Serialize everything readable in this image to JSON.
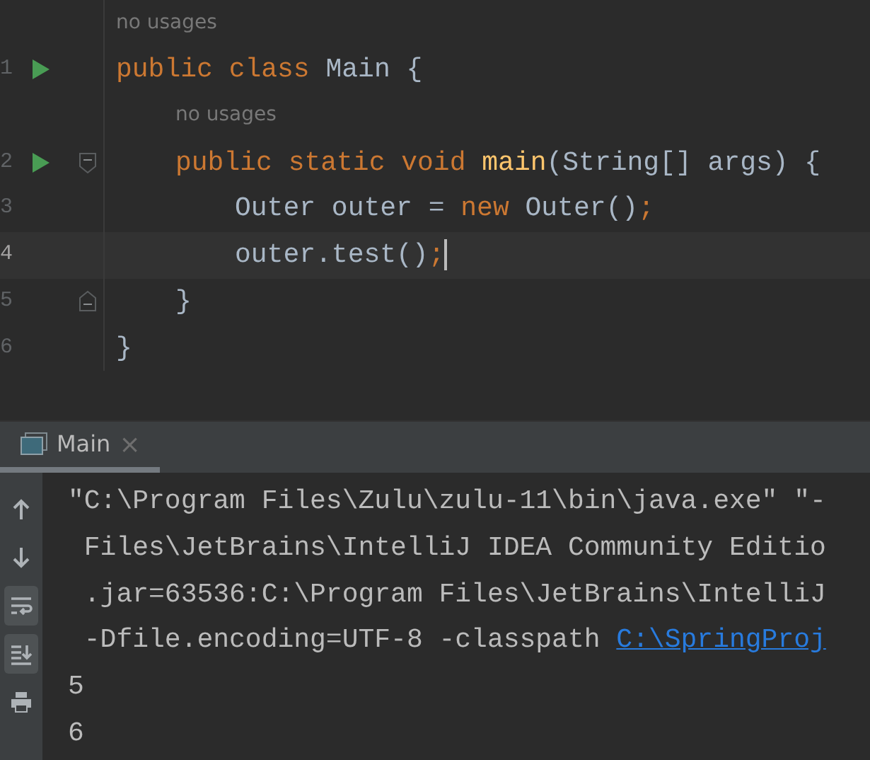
{
  "editor": {
    "rows": [
      {
        "kind": "hint",
        "text": "no usages"
      },
      {
        "kind": "code",
        "number": "1",
        "run": true,
        "fold_start": false,
        "fold_end": false,
        "current": false,
        "caret": false,
        "tokens": [
          {
            "kind": "keyword",
            "text": "public class "
          },
          {
            "kind": "plain",
            "text": "Main {"
          }
        ],
        "children": [
          {
            "kind": "hint",
            "text": "no usages"
          },
          {
            "kind": "code",
            "number": "2",
            "run": true,
            "fold_start": true,
            "fold_end": false,
            "current": false,
            "caret": false,
            "tokens": [
              {
                "kind": "keyword",
                "text": "public static void "
              },
              {
                "kind": "method",
                "text": "main"
              },
              {
                "kind": "plain",
                "text": "(String[] args) {"
              }
            ],
            "children": [
              {
                "kind": "code",
                "number": "3",
                "run": false,
                "fold_start": false,
                "fold_end": false,
                "current": false,
                "caret": false,
                "tokens": [
                  {
                    "kind": "plain",
                    "text": "Outer outer = "
                  },
                  {
                    "kind": "keyword",
                    "text": "new "
                  },
                  {
                    "kind": "plain",
                    "text": "Outer()"
                  },
                  {
                    "kind": "keyword",
                    "text": ";"
                  }
                ]
              },
              {
                "kind": "code",
                "number": "4",
                "run": false,
                "fold_start": false,
                "fold_end": false,
                "current": true,
                "caret": true,
                "tokens": [
                  {
                    "kind": "plain",
                    "text": "outer.test()"
                  },
                  {
                    "kind": "keyword",
                    "text": ";"
                  }
                ]
              }
            ]
          },
          {
            "kind": "code",
            "number": "5",
            "run": false,
            "fold_start": false,
            "fold_end": true,
            "current": false,
            "caret": false,
            "tokens": [
              {
                "kind": "plain",
                "text": "}"
              }
            ]
          }
        ]
      },
      {
        "kind": "code",
        "number": "6",
        "run": false,
        "fold_start": false,
        "fold_end": false,
        "current": false,
        "caret": false,
        "tokens": [
          {
            "kind": "plain",
            "text": "}"
          }
        ]
      }
    ]
  },
  "run_panel": {
    "tabs": [
      {
        "label": "Main",
        "close": "×",
        "selected": true
      }
    ],
    "toolbar": [
      {
        "kind": "up",
        "selected": false
      },
      {
        "kind": "down",
        "selected": false
      },
      {
        "kind": "wrap",
        "selected": true
      },
      {
        "kind": "scroll-end",
        "selected": true
      },
      {
        "kind": "print",
        "selected": false
      }
    ],
    "output": [
      {
        "text": "\"C:\\Program Files\\Zulu\\zulu-11\\bin\\java.exe\" \"-"
      },
      {
        "text": " Files\\JetBrains\\IntelliJ IDEA Community Editio"
      },
      {
        "text": " .jar=63536:C:\\Program Files\\JetBrains\\IntelliJ"
      },
      {
        "text": " -Dfile.encoding=UTF-8 -classpath ",
        "link": "C:\\SpringProj"
      },
      {
        "text": "5"
      },
      {
        "text": "6"
      }
    ]
  }
}
